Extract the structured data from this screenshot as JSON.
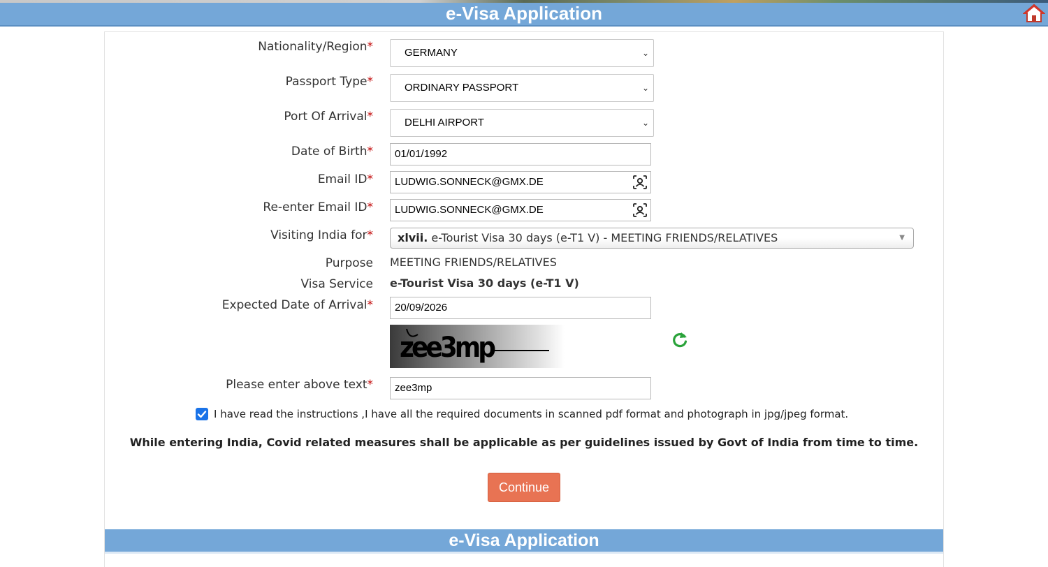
{
  "header": {
    "title": "e-Visa Application"
  },
  "form": {
    "nationality": {
      "label": "Nationality/Region",
      "required": "*",
      "value": "GERMANY"
    },
    "passport_type": {
      "label": "Passport Type",
      "required": "*",
      "value": "ORDINARY PASSPORT"
    },
    "port_of_arrival": {
      "label": "Port Of Arrival",
      "required": "*",
      "value": "DELHI AIRPORT"
    },
    "dob": {
      "label": "Date of Birth",
      "required": "*",
      "value": "01/01/1992"
    },
    "email": {
      "label": "Email ID",
      "required": "*",
      "value": "LUDWIG.SONNECK@GMX.DE"
    },
    "email_confirm": {
      "label": "Re-enter Email ID",
      "required": "*",
      "value": "LUDWIG.SONNECK@GMX.DE"
    },
    "visiting_for": {
      "label": "Visiting India for",
      "required": "*",
      "prefix": "xlvii.",
      "value": "e-Tourist Visa 30 days (e-T1 V) - MEETING FRIENDS/RELATIVES"
    },
    "purpose": {
      "label": "Purpose",
      "value": "MEETING FRIENDS/RELATIVES"
    },
    "visa_service": {
      "label": "Visa Service",
      "value": "e-Tourist Visa 30 days (e-T1 V)"
    },
    "arrival_date": {
      "label": "Expected Date of Arrival",
      "required": "*",
      "value": "20/09/2026"
    },
    "captcha": {
      "image_text": "zee3mp"
    },
    "captcha_input": {
      "label": "Please enter above text",
      "required": "*",
      "value": "zee3mp"
    },
    "instructions_checkbox": {
      "checked": true,
      "text": "I have read the instructions ,I have all the required documents in scanned pdf format and photograph in jpg/jpeg format."
    },
    "covid_notice": "While entering India, Covid related measures shall be applicable as per guidelines issued by Govt of India from time to time.",
    "continue_label": "Continue"
  },
  "footer": {
    "title": "e-Visa Application"
  },
  "colors": {
    "header_bg": "#74a7d8",
    "required": "#c00000",
    "continue_bg": "#e87353",
    "refresh": "#2aa33a",
    "checkbox": "#1a73e8"
  },
  "icons": {
    "home": "home-icon",
    "contact": "contact-icon",
    "refresh": "refresh-icon",
    "check": "checkmark-icon"
  }
}
